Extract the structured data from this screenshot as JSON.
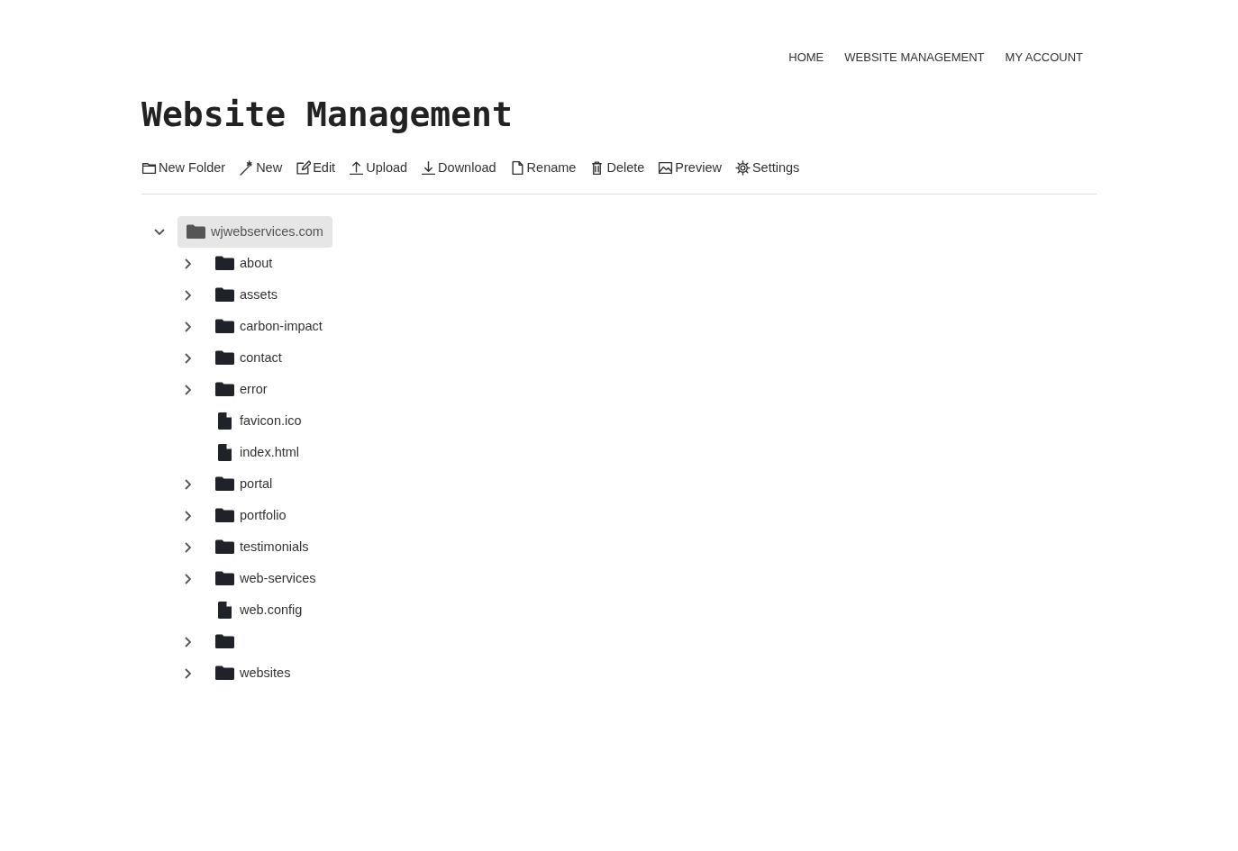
{
  "nav": [
    {
      "label": "HOME"
    },
    {
      "label": "WEBSITE MANAGEMENT"
    },
    {
      "label": "MY ACCOUNT"
    }
  ],
  "page_title": "Website Management",
  "toolbar": [
    {
      "kind": "folder",
      "label": "New Folder"
    },
    {
      "kind": "wand",
      "label": "New"
    },
    {
      "kind": "edit",
      "label": "Edit"
    },
    {
      "kind": "upload",
      "label": "Upload"
    },
    {
      "kind": "download",
      "label": "Download"
    },
    {
      "kind": "file",
      "label": "Rename"
    },
    {
      "kind": "trash",
      "label": "Delete"
    },
    {
      "kind": "image",
      "label": "Preview"
    },
    {
      "kind": "gear",
      "label": "Settings"
    }
  ],
  "tree": {
    "name": "wjwebservices.com",
    "kind": "folder",
    "expanded": true,
    "selected": true,
    "children": [
      {
        "name": "about",
        "kind": "folder",
        "expanded": false
      },
      {
        "name": "assets",
        "kind": "folder",
        "expanded": false
      },
      {
        "name": "carbon-impact",
        "kind": "folder",
        "expanded": false
      },
      {
        "name": "contact",
        "kind": "folder",
        "expanded": false
      },
      {
        "name": "error",
        "kind": "folder",
        "expanded": false
      },
      {
        "name": "favicon.ico",
        "kind": "file"
      },
      {
        "name": "index.html",
        "kind": "file"
      },
      {
        "name": "portal",
        "kind": "folder",
        "expanded": false
      },
      {
        "name": "portfolio",
        "kind": "folder",
        "expanded": false
      },
      {
        "name": "testimonials",
        "kind": "folder",
        "expanded": false
      },
      {
        "name": "web-services",
        "kind": "folder",
        "expanded": false
      },
      {
        "name": "web.config",
        "kind": "file"
      },
      {
        "kind": "folder",
        "expanded": false
      },
      {
        "name": "websites",
        "kind": "folder",
        "expanded": false
      }
    ]
  }
}
